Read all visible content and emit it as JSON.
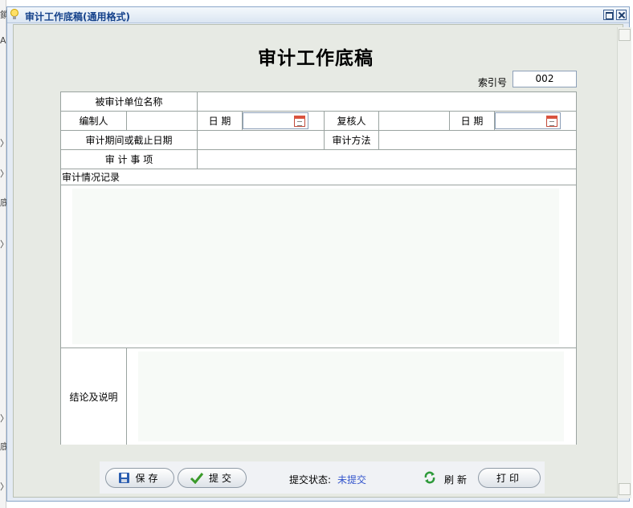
{
  "background": {
    "edge_texts": [
      "鎖",
      "A",
      "〉",
      "〉",
      "底",
      "〉",
      "〉",
      "底",
      "〉"
    ]
  },
  "window": {
    "title": "审计工作底稿(通用格式)"
  },
  "doc": {
    "title": "审计工作底稿",
    "index_label": "索引号",
    "index_value": "002"
  },
  "form": {
    "audited_unit_label": "被审计单位名称",
    "preparer_label": "编制人",
    "date_label": "日  期",
    "reviewer_label": "复核人",
    "date2_label": "日  期",
    "period_label": "审计期间或截止日期",
    "method_label": "审计方法",
    "matters_label": "审  计  事  项",
    "record_label": "审计情况记录",
    "conclusion_label": "结论及说明"
  },
  "toolbar": {
    "save_label": "保存",
    "submit_label": "提交",
    "status_label": "提交状态:",
    "status_value": "未提交",
    "refresh_label": "刷新",
    "print_label": "打印"
  },
  "colors": {
    "accent": "#15428b",
    "status_value": "#3355cc",
    "save_icon": "#2a5db0",
    "check_icon": "#3a9a2a",
    "refresh_icon": "#2e9a3a"
  }
}
